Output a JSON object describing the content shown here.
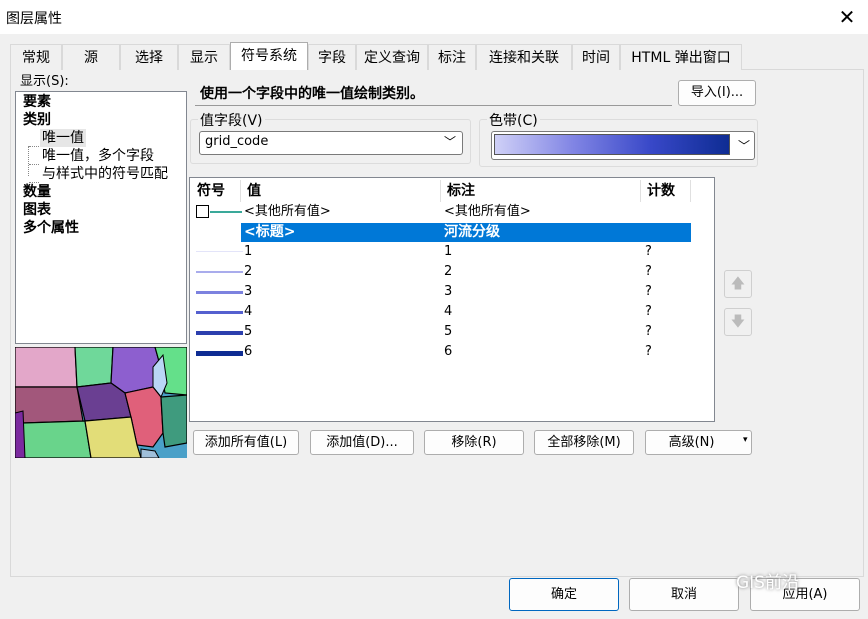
{
  "window": {
    "title": "图层属性"
  },
  "tabs": [
    "常规",
    "源",
    "选择",
    "显示",
    "符号系统",
    "字段",
    "定义查询",
    "标注",
    "连接和关联",
    "时间",
    "HTML 弹出窗口"
  ],
  "show_label": "显示(S):",
  "tree": {
    "features": "要素",
    "categories": "类别",
    "unique_values": "唯一值",
    "unique_values_many": "唯一值，多个字段",
    "match_style": "与样式中的符号匹配",
    "quantities": "数量",
    "charts": "图表",
    "multiple_attributes": "多个属性"
  },
  "description": "使用一个字段中的唯一值绘制类别。",
  "import_button": "导入(I)...",
  "value_field": {
    "label": "值字段(V)",
    "value": "grid_code"
  },
  "color_ramp": {
    "label": "色带(C)",
    "colors": [
      "#cfd0f7",
      "#8185e4",
      "#3848c8",
      "#0e2c93"
    ]
  },
  "table": {
    "headers": [
      "符号",
      "值",
      "标注",
      "计数"
    ],
    "other": {
      "value": "<其他所有值>",
      "label": "<其他所有值>"
    },
    "heading": {
      "value": "<标题>",
      "label": "河流分级"
    },
    "rows": [
      {
        "value": "1",
        "label": "1",
        "count": "?",
        "color": "#e3e4f9"
      },
      {
        "value": "2",
        "label": "2",
        "count": "?",
        "color": "#a9acec"
      },
      {
        "value": "3",
        "label": "3",
        "count": "?",
        "color": "#7c82df"
      },
      {
        "value": "4",
        "label": "4",
        "count": "?",
        "color": "#5560cf"
      },
      {
        "value": "5",
        "label": "5",
        "count": "?",
        "color": "#2c3fae"
      },
      {
        "value": "6",
        "label": "6",
        "count": "?",
        "color": "#0e2c93"
      }
    ]
  },
  "buttons": {
    "add_all": "添加所有值(L)",
    "add_values": "添加值(D)...",
    "remove": "移除(R)",
    "remove_all": "全部移除(M)",
    "advanced": "高级(N)"
  },
  "footer": {
    "ok": "确定",
    "cancel": "取消",
    "apply": "应用(A)"
  },
  "watermark": "GIS前沿"
}
